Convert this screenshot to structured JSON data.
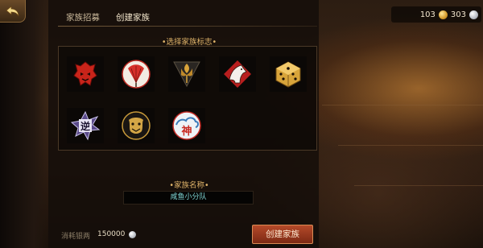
{
  "currency": {
    "gold": "103",
    "silver": "303"
  },
  "tabs": [
    {
      "label": "家族招募",
      "active": false
    },
    {
      "label": "创建家族",
      "active": true
    }
  ],
  "emblem_section": {
    "title": "•选择家族标志•"
  },
  "emblems": [
    {
      "name": "red-demon-mask"
    },
    {
      "name": "red-fan"
    },
    {
      "name": "golden-lotus"
    },
    {
      "name": "white-horse"
    },
    {
      "name": "golden-dice"
    },
    {
      "name": "ni-star"
    },
    {
      "name": "golden-dragon"
    },
    {
      "name": "shen-cloud"
    }
  ],
  "name_section": {
    "title": "•家族名称•",
    "value": "咸鱼小分队"
  },
  "cost": {
    "label": "消耗银两",
    "value": "150000"
  },
  "create_button": {
    "label": "创建家族"
  },
  "colors": {
    "accent": "#e0b46a",
    "button": "#b54a2a",
    "input_text": "#7fd6d4"
  }
}
